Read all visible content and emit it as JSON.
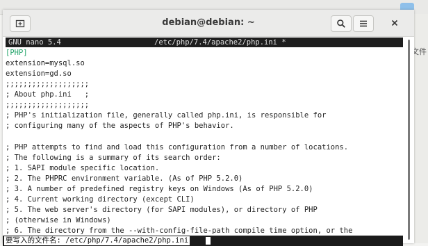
{
  "window": {
    "title": "debian@debian: ~"
  },
  "titlebar": {
    "new_tab_icon": "new-tab-icon",
    "search_icon": "search-icon",
    "menu_icon": "hamburger-menu-icon",
    "close_icon": "close-icon"
  },
  "background": {
    "side_text": "文件"
  },
  "nano": {
    "version": "GNU nano 5.4",
    "filename": "/etc/php/7.4/apache2/php.ini *",
    "lines": [
      "[PHP]",
      "extension=mysql.so",
      "extension=gd.so",
      ";;;;;;;;;;;;;;;;;;;",
      "; About php.ini   ;",
      ";;;;;;;;;;;;;;;;;;;",
      "; PHP's initialization file, generally called php.ini, is responsible for",
      "; configuring many of the aspects of PHP's behavior.",
      "",
      "; PHP attempts to find and load this configuration from a number of locations.",
      "; The following is a summary of its search order:",
      "; 1. SAPI module specific location.",
      "; 2. The PHPRC environment variable. (As of PHP 5.2.0)",
      "; 3. A number of predefined registry keys on Windows (As of PHP 5.2.0)",
      "; 4. Current working directory (except CLI)",
      "; 5. The web server's directory (for SAPI modules), or directory of PHP",
      "; (otherwise in Windows)",
      "; 6. The directory from the --with-config-file-path compile time option, or the"
    ],
    "status_prompt": "要写入的文件名: /etc/php/7.4/apache2/php.ini"
  }
}
